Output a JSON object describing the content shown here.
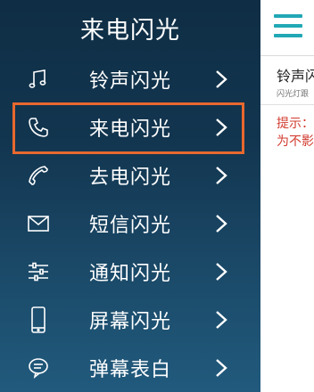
{
  "drawer": {
    "title": "来电闪光",
    "items": [
      {
        "label": "铃声闪光",
        "icon": "music-note-icon"
      },
      {
        "label": "来电闪光",
        "icon": "phone-icon",
        "selected": true
      },
      {
        "label": "去电闪光",
        "icon": "outgoing-call-icon"
      },
      {
        "label": "短信闪光",
        "icon": "envelope-icon"
      },
      {
        "label": "通知闪光",
        "icon": "sliders-icon"
      },
      {
        "label": "屏幕闪光",
        "icon": "smartphone-icon"
      },
      {
        "label": "弹幕表白",
        "icon": "chat-bubble-icon"
      }
    ],
    "selection_color": "#e8682e"
  },
  "peek": {
    "title": "铃声闪",
    "subtitle": "闪光灯跟",
    "warning_line1": "提示：",
    "warning_line2": "为不影",
    "accent": "#22a8b5",
    "warning_color": "#d23b2f"
  }
}
